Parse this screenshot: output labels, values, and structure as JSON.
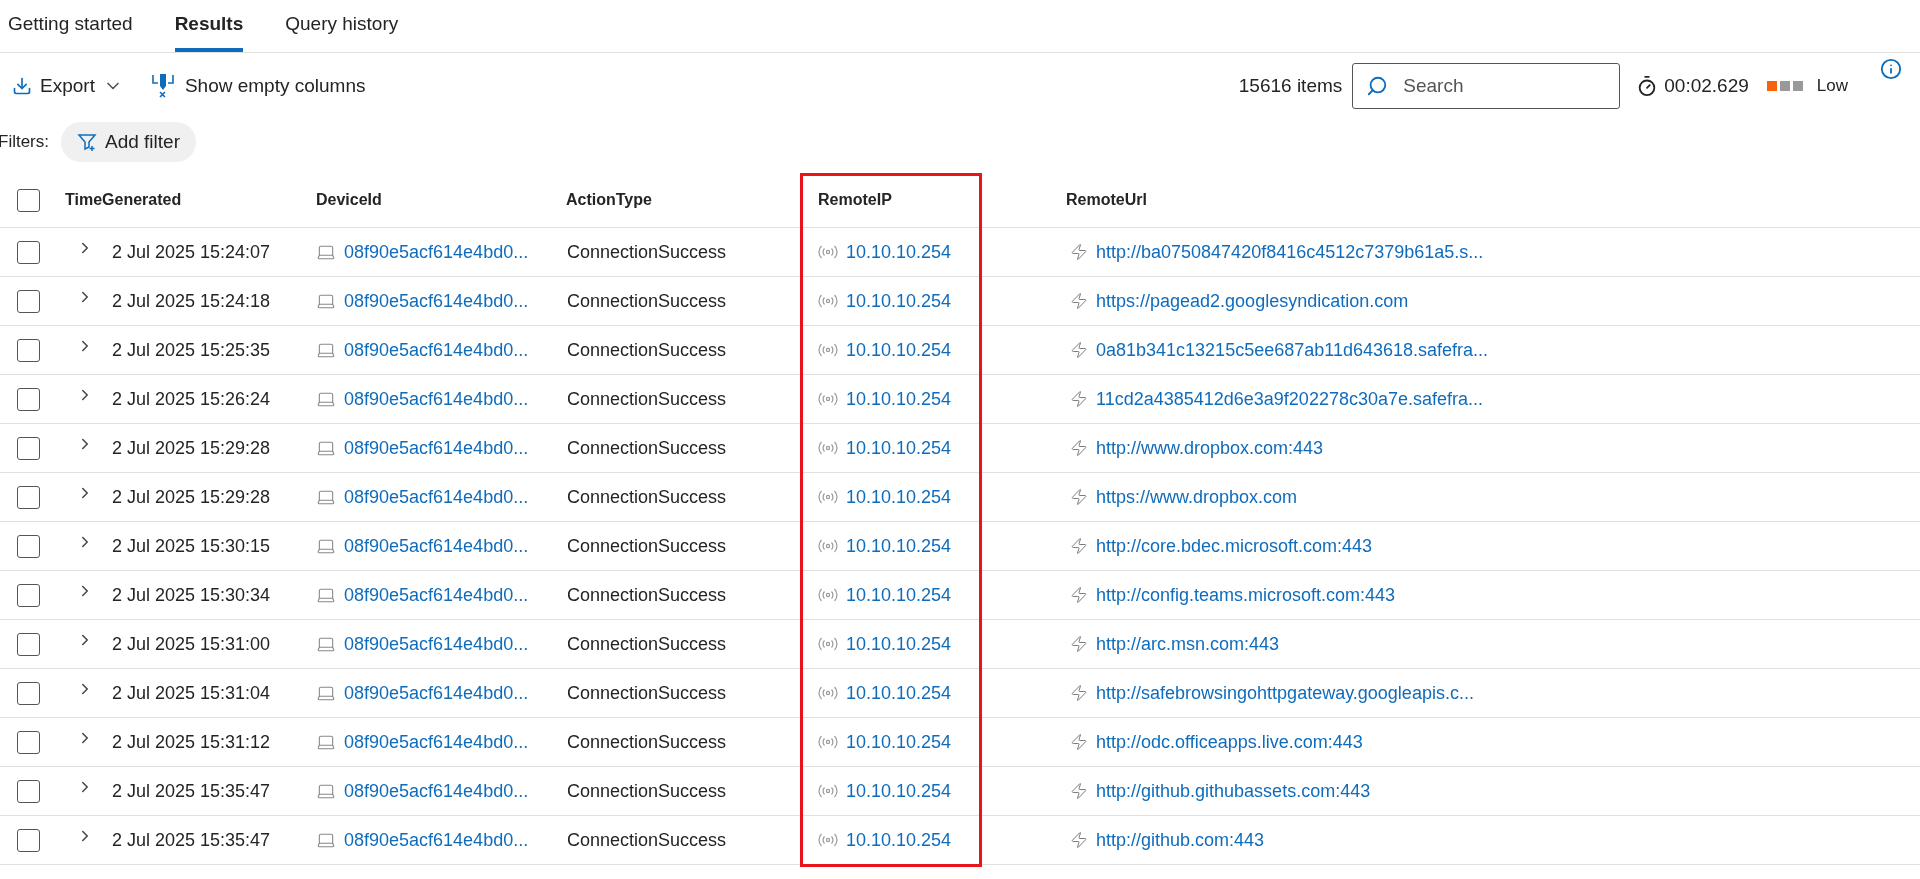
{
  "tabs": [
    {
      "label": "Getting started",
      "selected": false
    },
    {
      "label": "Results",
      "selected": true
    },
    {
      "label": "Query history",
      "selected": false
    }
  ],
  "toolbar": {
    "export": "Export",
    "show_empty_columns": "Show empty columns",
    "item_count": "15616 items",
    "search": {
      "placeholder": "Search"
    },
    "duration": "00:02.629",
    "performance": {
      "level": 0.34,
      "label": "Low"
    }
  },
  "filters": {
    "label": "Filters:",
    "add_filter": "Add filter"
  },
  "table": {
    "select_all": {
      "checked": false
    },
    "columns": [
      {
        "label": "TimeGenerated",
        "highlighted": false
      },
      {
        "label": "DeviceId",
        "highlighted": false
      },
      {
        "label": "ActionType",
        "highlighted": false
      },
      {
        "label": "RemoteIP",
        "highlighted": true
      },
      {
        "label": "RemoteUrl",
        "highlighted": false
      }
    ],
    "rows": [
      {
        "checked": false,
        "expanded": false,
        "time": "2 Jul 2025 15:24:07",
        "device": "08f90e5acf614e4bd0...",
        "action": "ConnectionSuccess",
        "ip": "10.10.10.254",
        "url": "http://ba0750847420f8416c4512c7379b61a5.s..."
      },
      {
        "checked": false,
        "expanded": false,
        "time": "2 Jul 2025 15:24:18",
        "device": "08f90e5acf614e4bd0...",
        "action": "ConnectionSuccess",
        "ip": "10.10.10.254",
        "url": "https://pagead2.googlesyndication.com"
      },
      {
        "checked": false,
        "expanded": false,
        "time": "2 Jul 2025 15:25:35",
        "device": "08f90e5acf614e4bd0...",
        "action": "ConnectionSuccess",
        "ip": "10.10.10.254",
        "url": "0a81b341c13215c5ee687ab11d643618.safefra..."
      },
      {
        "checked": false,
        "expanded": false,
        "time": "2 Jul 2025 15:26:24",
        "device": "08f90e5acf614e4bd0...",
        "action": "ConnectionSuccess",
        "ip": "10.10.10.254",
        "url": "11cd2a4385412d6e3a9f202278c30a7e.safefra..."
      },
      {
        "checked": false,
        "expanded": false,
        "time": "2 Jul 2025 15:29:28",
        "device": "08f90e5acf614e4bd0...",
        "action": "ConnectionSuccess",
        "ip": "10.10.10.254",
        "url": "http://www.dropbox.com:443"
      },
      {
        "checked": false,
        "expanded": false,
        "time": "2 Jul 2025 15:29:28",
        "device": "08f90e5acf614e4bd0...",
        "action": "ConnectionSuccess",
        "ip": "10.10.10.254",
        "url": "https://www.dropbox.com"
      },
      {
        "checked": false,
        "expanded": false,
        "time": "2 Jul 2025 15:30:15",
        "device": "08f90e5acf614e4bd0...",
        "action": "ConnectionSuccess",
        "ip": "10.10.10.254",
        "url": "http://core.bdec.microsoft.com:443"
      },
      {
        "checked": false,
        "expanded": false,
        "time": "2 Jul 2025 15:30:34",
        "device": "08f90e5acf614e4bd0...",
        "action": "ConnectionSuccess",
        "ip": "10.10.10.254",
        "url": "http://config.teams.microsoft.com:443"
      },
      {
        "checked": false,
        "expanded": false,
        "time": "2 Jul 2025 15:31:00",
        "device": "08f90e5acf614e4bd0...",
        "action": "ConnectionSuccess",
        "ip": "10.10.10.254",
        "url": "http://arc.msn.com:443"
      },
      {
        "checked": false,
        "expanded": false,
        "time": "2 Jul 2025 15:31:04",
        "device": "08f90e5acf614e4bd0...",
        "action": "ConnectionSuccess",
        "ip": "10.10.10.254",
        "url": "http://safebrowsingohttpgateway.googleapis.c..."
      },
      {
        "checked": false,
        "expanded": false,
        "time": "2 Jul 2025 15:31:12",
        "device": "08f90e5acf614e4bd0...",
        "action": "ConnectionSuccess",
        "ip": "10.10.10.254",
        "url": "http://odc.officeapps.live.com:443"
      },
      {
        "checked": false,
        "expanded": false,
        "time": "2 Jul 2025 15:35:47",
        "device": "08f90e5acf614e4bd0...",
        "action": "ConnectionSuccess",
        "ip": "10.10.10.254",
        "url": "http://github.githubassets.com:443"
      },
      {
        "checked": false,
        "expanded": false,
        "time": "2 Jul 2025 15:35:47",
        "device": "08f90e5acf614e4bd0...",
        "action": "ConnectionSuccess",
        "ip": "10.10.10.254",
        "url": "http://github.com:443"
      }
    ]
  }
}
